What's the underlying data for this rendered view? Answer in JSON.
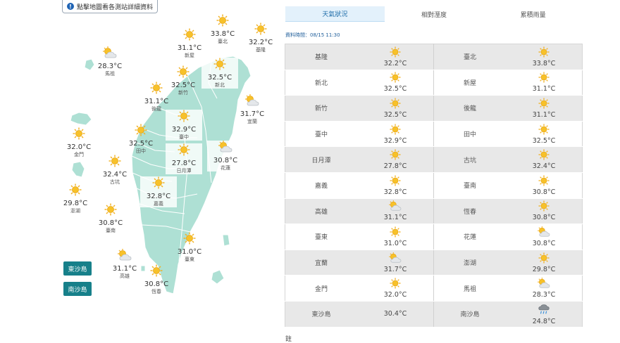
{
  "hint_text": "點擊地圖看各測站詳細資料",
  "tabs": [
    {
      "label": "天氣狀況",
      "active": true
    },
    {
      "label": "相對溼度",
      "active": false
    },
    {
      "label": "累積雨量",
      "active": false
    }
  ],
  "datatime": "資料時間：08/15 11:30",
  "islands": {
    "dongsha": "東沙島",
    "nansha": "南沙島"
  },
  "map_cities": [
    {
      "name": "臺北",
      "temp": "33.8°C",
      "icon": "sun-icon"
    },
    {
      "name": "基隆",
      "temp": "32.2°C",
      "icon": "sun-icon"
    },
    {
      "name": "新屋",
      "temp": "31.1°C",
      "icon": "sun-icon"
    },
    {
      "name": "新北",
      "temp": "32.5°C",
      "icon": "sun-icon"
    },
    {
      "name": "新竹",
      "temp": "32.5°C",
      "icon": "sun-icon"
    },
    {
      "name": "馬祖",
      "temp": "28.3°C",
      "icon": "partly-cloudy-icon"
    },
    {
      "name": "宜蘭",
      "temp": "31.7°C",
      "icon": "partly-cloudy-icon"
    },
    {
      "name": "後龍",
      "temp": "31.1°C",
      "icon": "sun-icon"
    },
    {
      "name": "臺中",
      "temp": "32.9°C",
      "icon": "sun-icon"
    },
    {
      "name": "金門",
      "temp": "32.0°C",
      "icon": "sun-icon"
    },
    {
      "name": "田中",
      "temp": "32.5°C",
      "icon": "sun-icon"
    },
    {
      "name": "日月潭",
      "temp": "27.8°C",
      "icon": "sun-icon"
    },
    {
      "name": "花蓮",
      "temp": "30.8°C",
      "icon": "partly-cloudy-icon"
    },
    {
      "name": "古坑",
      "temp": "32.4°C",
      "icon": "sun-icon"
    },
    {
      "name": "澎湖",
      "temp": "29.8°C",
      "icon": "sun-icon"
    },
    {
      "name": "嘉義",
      "temp": "32.8°C",
      "icon": "sun-icon"
    },
    {
      "name": "臺南",
      "temp": "30.8°C",
      "icon": "sun-icon"
    },
    {
      "name": "臺東",
      "temp": "31.0°C",
      "icon": "sun-icon"
    },
    {
      "name": "高雄",
      "temp": "31.1°C",
      "icon": "partly-cloudy-icon"
    },
    {
      "name": "恆春",
      "temp": "30.8°C",
      "icon": "sun-icon"
    }
  ],
  "table_rows": [
    [
      {
        "name": "基隆",
        "temp": "32.2°C",
        "icon": "sun-icon"
      },
      {
        "name": "臺北",
        "temp": "33.8°C",
        "icon": "sun-icon"
      }
    ],
    [
      {
        "name": "新北",
        "temp": "32.5°C",
        "icon": "sun-icon"
      },
      {
        "name": "新屋",
        "temp": "31.1°C",
        "icon": "sun-icon"
      }
    ],
    [
      {
        "name": "新竹",
        "temp": "32.5°C",
        "icon": "sun-icon"
      },
      {
        "name": "後龍",
        "temp": "31.1°C",
        "icon": "sun-icon"
      }
    ],
    [
      {
        "name": "臺中",
        "temp": "32.9°C",
        "icon": "sun-icon"
      },
      {
        "name": "田中",
        "temp": "32.5°C",
        "icon": "sun-icon"
      }
    ],
    [
      {
        "name": "日月潭",
        "temp": "27.8°C",
        "icon": "sun-icon"
      },
      {
        "name": "古坑",
        "temp": "32.4°C",
        "icon": "sun-icon"
      }
    ],
    [
      {
        "name": "嘉義",
        "temp": "32.8°C",
        "icon": "sun-icon"
      },
      {
        "name": "臺南",
        "temp": "30.8°C",
        "icon": "sun-icon"
      }
    ],
    [
      {
        "name": "高雄",
        "temp": "31.1°C",
        "icon": "partly-cloudy-icon"
      },
      {
        "name": "恆春",
        "temp": "30.8°C",
        "icon": "sun-icon"
      }
    ],
    [
      {
        "name": "臺東",
        "temp": "31.0°C",
        "icon": "sun-icon"
      },
      {
        "name": "花蓮",
        "temp": "30.8°C",
        "icon": "partly-cloudy-icon"
      }
    ],
    [
      {
        "name": "宜蘭",
        "temp": "31.7°C",
        "icon": "partly-cloudy-icon"
      },
      {
        "name": "澎湖",
        "temp": "29.8°C",
        "icon": "sun-icon"
      }
    ],
    [
      {
        "name": "金門",
        "temp": "32.0°C",
        "icon": "sun-icon"
      },
      {
        "name": "馬祖",
        "temp": "28.3°C",
        "icon": "partly-cloudy-icon"
      }
    ],
    [
      {
        "name": "東沙島",
        "temp": "30.4°C",
        "icon": ""
      },
      {
        "name": "南沙島",
        "temp": "24.8°C",
        "icon": "rain-cloud-icon"
      }
    ]
  ],
  "note": "註",
  "colors": {
    "land": "#aee0d4",
    "land_border": "#ffffff",
    "accent": "#17808a",
    "sun": "#f2b01e"
  }
}
